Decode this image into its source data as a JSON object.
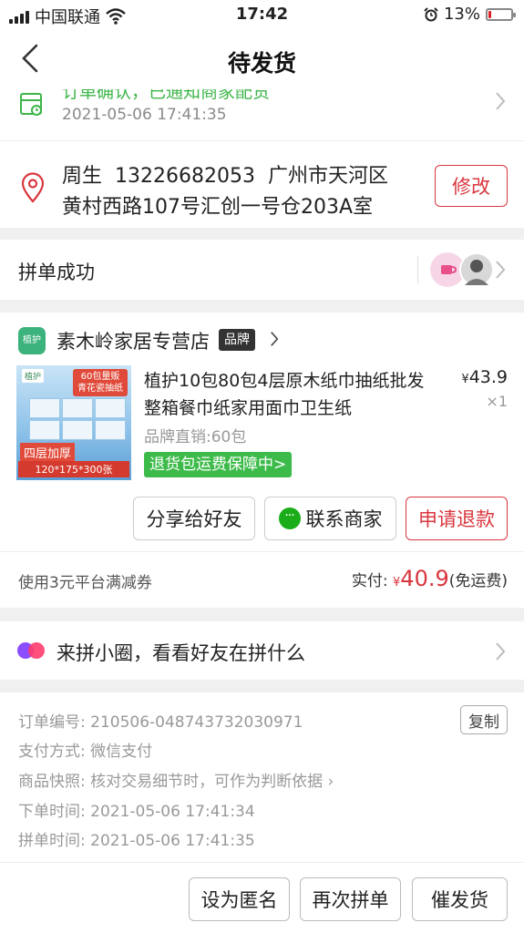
{
  "status_bar": {
    "carrier": "中国联通",
    "time": "17:42",
    "battery": "13%",
    "battery_level": 0.13
  },
  "nav": {
    "title": "待发货"
  },
  "tracking": {
    "status": "订单确认，已通知商家配货",
    "time": "2021-05-06 17:41:35"
  },
  "address": {
    "line1": "周生  13226682053  广州市天河区",
    "line2": "黄村西路107号汇创一号仓203A室",
    "edit_label": "修改"
  },
  "group": {
    "label": "拼单成功"
  },
  "order": {
    "shop_logo": "植护",
    "shop_name": "素木岭家居专营店",
    "brand_badge": "品牌",
    "product": {
      "title": "植护10包80包4层原木纸巾抽纸批发整箱餐巾纸家用面巾卫生纸",
      "currency": "¥",
      "price": "43.9",
      "qty": "×1",
      "spec": "品牌直销:60包",
      "guarantee": "退货包运费保障中>",
      "thumb_logo": "植护",
      "thumb_promo": "60包量贩 青花瓷抽纸",
      "thumb_layers": "四层加厚",
      "thumb_size": "120*175*300张"
    },
    "share_label": "分享给好友",
    "contact_label": "联系商家",
    "refund_label": "申请退款",
    "coupon": "使用3元平台满减券",
    "paid_prefix": "实付:",
    "paid_currency": "¥",
    "paid_amount": "40.9",
    "paid_suffix": "(免运费)"
  },
  "circle": {
    "text": "来拼小圈，看看好友在拼什么"
  },
  "info": {
    "order_no_label": "订单编号:",
    "order_no": "210506-048743732030971",
    "copy_label": "复制",
    "pay_label": "支付方式:",
    "pay": "微信支付",
    "snapshot_label": "商品快照:",
    "snapshot": "核对交易细节时，可作为判断依据",
    "ordered_label": "下单时间:",
    "ordered": "2021-05-06 17:41:34",
    "grouped_label": "拼单时间:",
    "grouped": "2021-05-06 17:41:35"
  },
  "bottom": {
    "anon_label": "设为匿名",
    "again_label": "再次拼单",
    "urge_label": "催发货"
  }
}
